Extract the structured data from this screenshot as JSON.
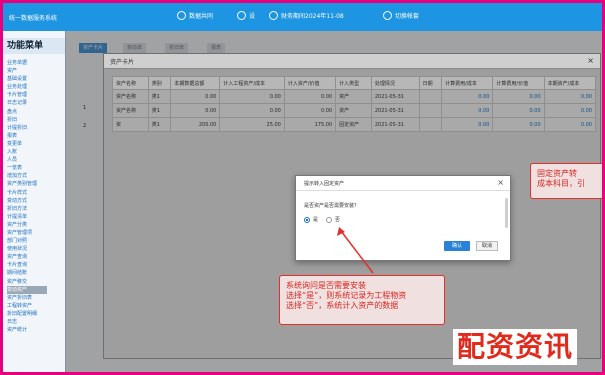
{
  "app": {
    "title": "统一数据服务系统",
    "header": [
      {
        "name": "data-icon",
        "label": "数据共同"
      },
      {
        "name": "gear-icon",
        "label": "设"
      },
      {
        "name": "clock-icon",
        "label": "财务期间2024年11-08"
      },
      {
        "name": "switch-icon",
        "label": "切换帐套"
      }
    ]
  },
  "sidebar": {
    "title": "功能菜单",
    "items": [
      "业务单据",
      "资产",
      "基础设置",
      "业务处理",
      "卡片管理",
      "日志记录",
      "盘点",
      "折旧",
      "计提折旧",
      "报表",
      "变更单",
      "入账",
      "人员",
      "一览表",
      "增加方式",
      "资产类别管理",
      "卡片样式",
      "变动方式",
      "折旧方法",
      "计提清单",
      "资产分类",
      "资产管理项",
      "部门对照",
      "使用状况",
      "资产查询",
      "卡片查询",
      "期间结账",
      "资产移交",
      "变动资产",
      "资产折旧表",
      "工程转资产",
      "折旧配置明细",
      "日志",
      "资产统计"
    ],
    "active_index": 28
  },
  "background_tabs": [
    "资产卡片",
    "变动单",
    "折旧单",
    "报表"
  ],
  "modal": {
    "title": "资产卡片",
    "columns": [
      "资产名称",
      "类别",
      "本期数据总额",
      "计入工程资产/成本",
      "计入资产/价值",
      "计入类型",
      "处理情况",
      "日期",
      "计算费用/成本",
      "计算费用/价值",
      "本期资产/成本"
    ],
    "rows": [
      [
        "资产名称",
        "类1",
        "0.00",
        "0.00",
        "0.00",
        "资产",
        "2021-05-31",
        "",
        "0.00",
        "0.00",
        "0.00"
      ],
      [
        "资产名称",
        "类1",
        "0.00",
        "0.00",
        "0.00",
        "资产",
        "2021-05-31",
        "",
        "0.00",
        "0.00",
        "0.00"
      ],
      [
        "资",
        "类1",
        "200.00",
        "25.00",
        "175.00",
        "固定资产",
        "2021-05-31",
        "",
        "0.00",
        "0.00",
        "0.00"
      ]
    ],
    "row_marks": [
      "1",
      "2"
    ]
  },
  "dialog": {
    "title": "提示转入固定资产",
    "question": "是否资产是否需要安装？",
    "options": [
      "是",
      "否"
    ],
    "selected": "是",
    "ok_label": "确认",
    "cancel_label": "取消"
  },
  "callouts": {
    "main": [
      "系统询问是否需要安装",
      "选择“是”，则系统记录为工程物资",
      "选择“否”，系统计入资产的数据"
    ],
    "side": [
      "固定资产转",
      "成本科目，引"
    ]
  },
  "watermark": "配资资讯",
  "colors": {
    "topbar": "#1e95e3",
    "accent_button": "#2a82d6",
    "annotation": "#e0312c",
    "border": "#e6007e"
  }
}
